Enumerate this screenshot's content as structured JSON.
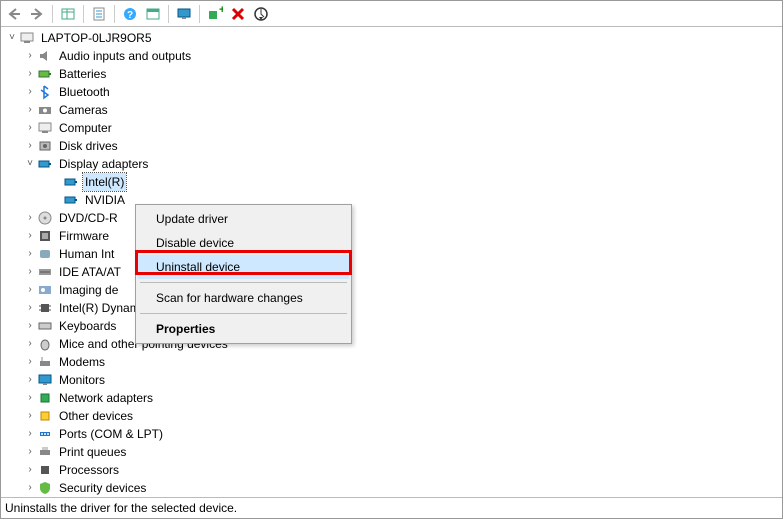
{
  "toolbar": {
    "back": "Back",
    "forward": "Forward",
    "show_hidden": "Show hidden devices",
    "properties": "Properties",
    "help": "Help",
    "action": "Action",
    "monitor": "View",
    "add": "Add",
    "remove": "Remove",
    "scan": "Scan for hardware changes"
  },
  "root": {
    "label": "LAPTOP-0LJR9OR5"
  },
  "nodes": [
    {
      "label": "Audio inputs and outputs",
      "icon": "speaker-icon"
    },
    {
      "label": "Batteries",
      "icon": "battery-icon"
    },
    {
      "label": "Bluetooth",
      "icon": "bluetooth-icon"
    },
    {
      "label": "Cameras",
      "icon": "camera-icon"
    },
    {
      "label": "Computer",
      "icon": "computer-icon"
    },
    {
      "label": "Disk drives",
      "icon": "disk-icon"
    },
    {
      "label": "Display adapters",
      "icon": "display-adapter-icon",
      "expanded": true
    },
    {
      "label": "DVD/CD-R",
      "icon": "dvd-icon"
    },
    {
      "label": "Firmware",
      "icon": "firmware-icon"
    },
    {
      "label": "Human Int",
      "icon": "hid-icon"
    },
    {
      "label": "IDE ATA/AT",
      "icon": "ide-icon"
    },
    {
      "label": "Imaging de",
      "icon": "imaging-icon"
    },
    {
      "label": "Intel(R) Dynamic Platform and Thermal Framework",
      "icon": "chip-icon"
    },
    {
      "label": "Keyboards",
      "icon": "keyboard-icon"
    },
    {
      "label": "Mice and other pointing devices",
      "icon": "mouse-icon"
    },
    {
      "label": "Modems",
      "icon": "modem-icon"
    },
    {
      "label": "Monitors",
      "icon": "monitor-icon"
    },
    {
      "label": "Network adapters",
      "icon": "network-icon"
    },
    {
      "label": "Other devices",
      "icon": "other-icon"
    },
    {
      "label": "Ports (COM & LPT)",
      "icon": "port-icon"
    },
    {
      "label": "Print queues",
      "icon": "printer-icon"
    },
    {
      "label": "Processors",
      "icon": "cpu-icon"
    },
    {
      "label": "Security devices",
      "icon": "security-icon"
    }
  ],
  "display_children": [
    {
      "label": "Intel(R)",
      "selected": true
    },
    {
      "label": "NVIDIA",
      "selected": false
    }
  ],
  "context_menu": {
    "items": [
      {
        "label": "Update driver",
        "sep_after": false
      },
      {
        "label": "Disable device",
        "sep_after": false
      },
      {
        "label": "Uninstall device",
        "sep_after": true,
        "highlighted": true,
        "hovered": true
      },
      {
        "label": "Scan for hardware changes",
        "sep_after": true
      },
      {
        "label": "Properties",
        "bold": true
      }
    ]
  },
  "status_text": "Uninstalls the driver for the selected device."
}
